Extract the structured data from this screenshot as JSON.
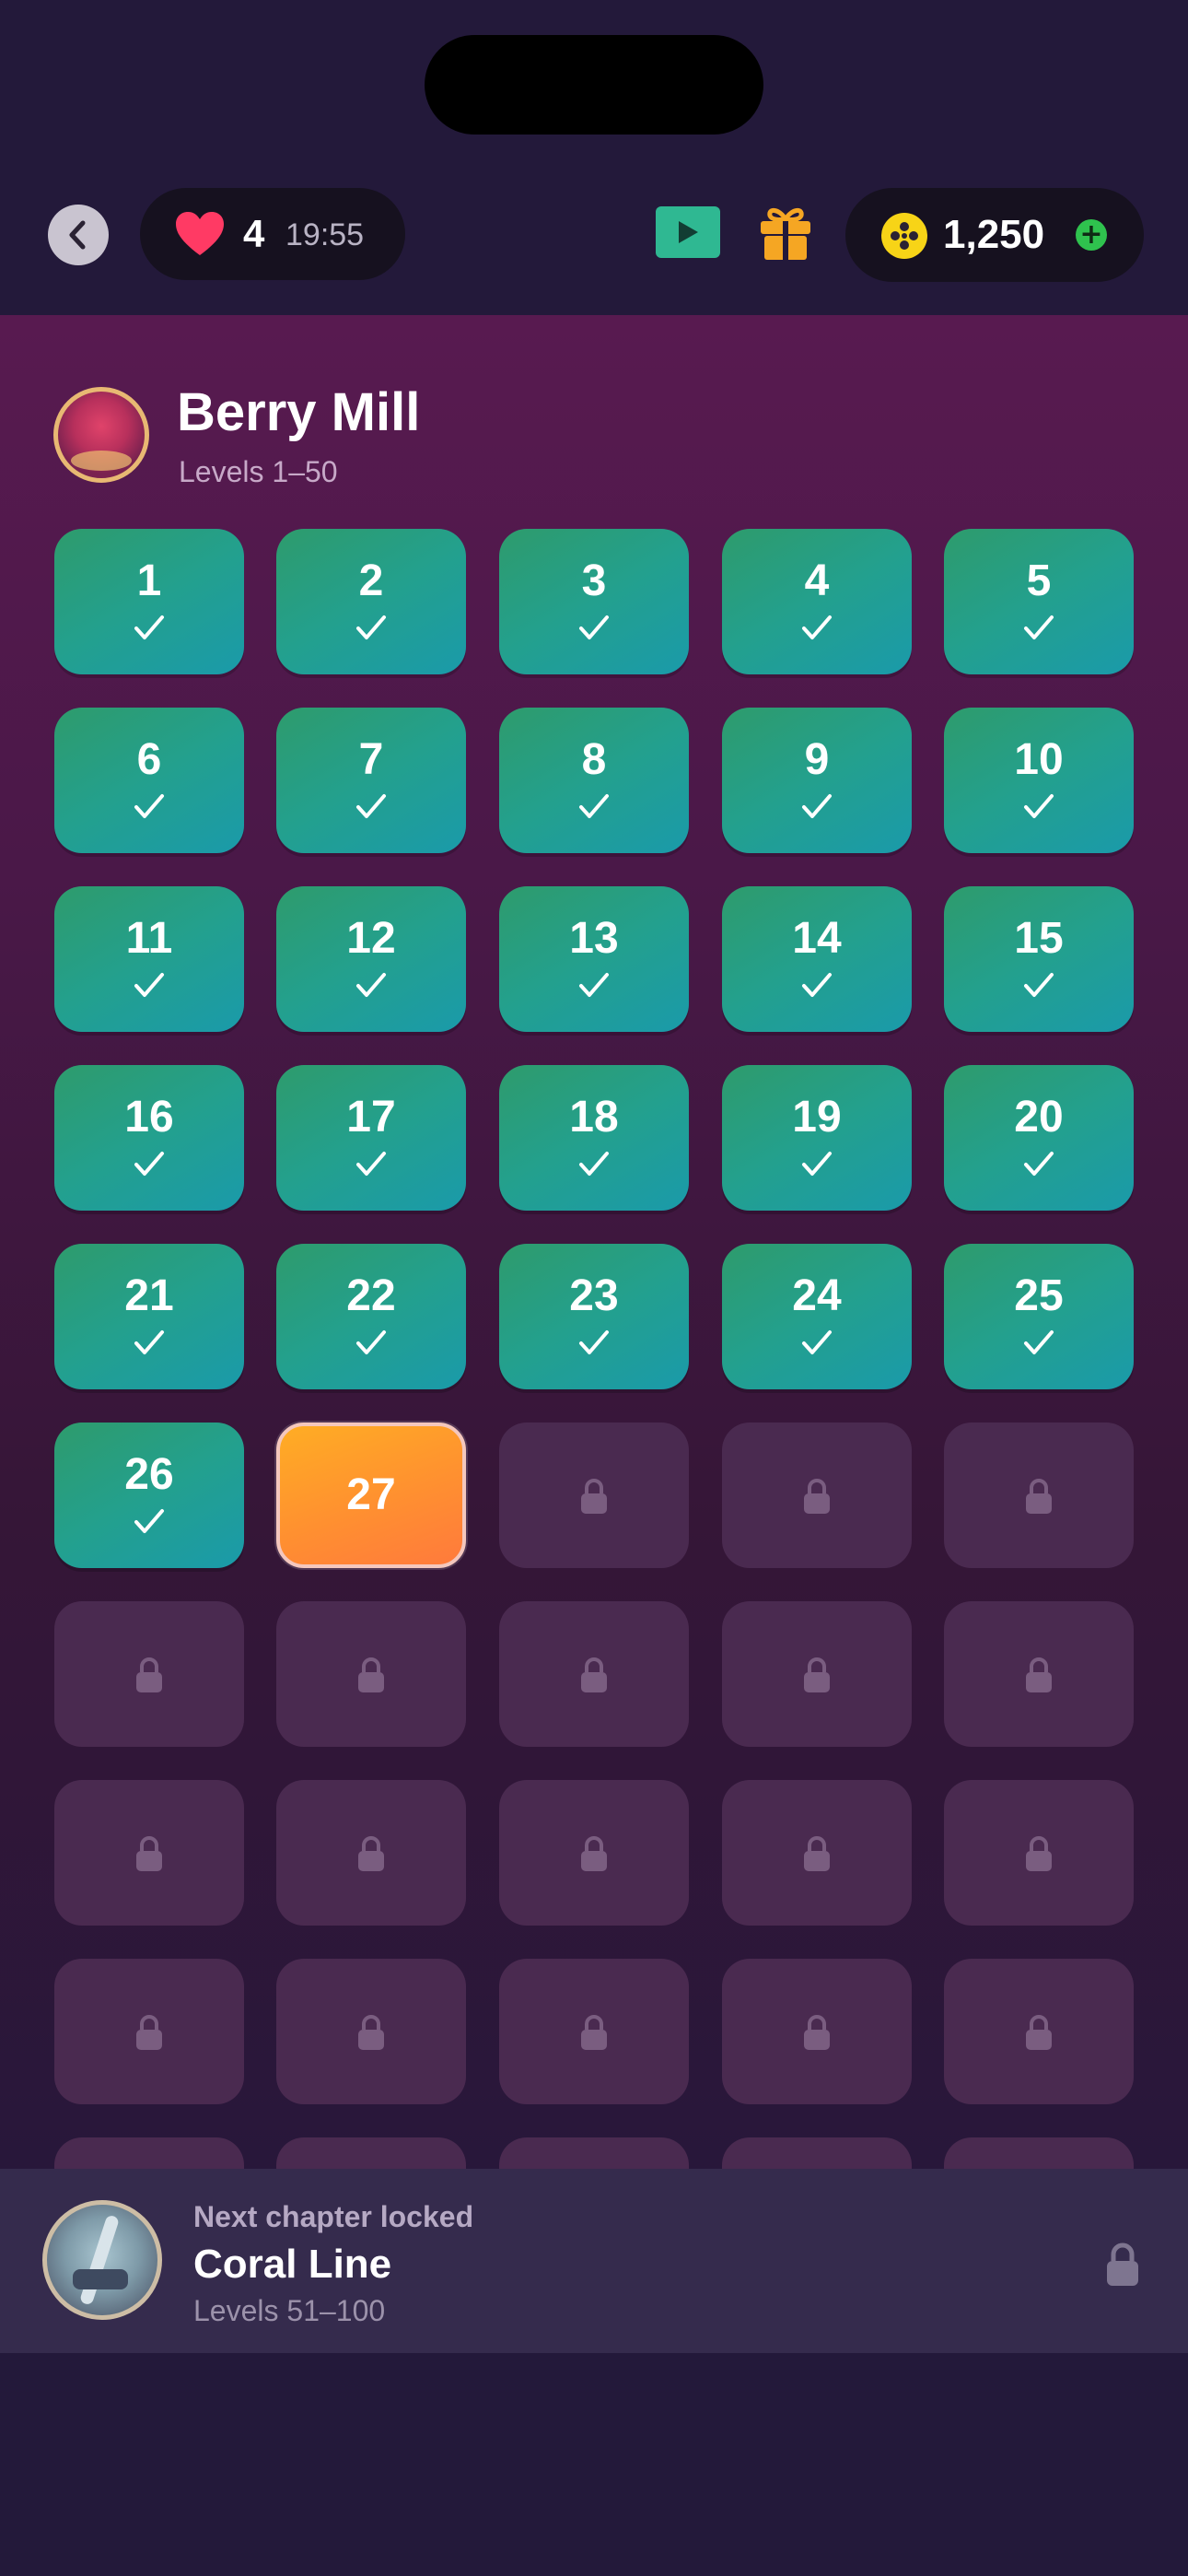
{
  "status": {
    "lives": "4",
    "timer": "19:55",
    "coins": "1,250"
  },
  "icons": {
    "back": "chevron-left-icon",
    "heart": "heart-icon",
    "video": "play-video-icon",
    "gift": "gift-icon",
    "coin": "coin-icon",
    "add": "plus-icon",
    "check": "check-icon",
    "lock": "lock-icon"
  },
  "colors": {
    "completed_tile": "#23a08e",
    "current_tile": "#ff9030",
    "locked_tile": "#4a2a50",
    "background": "#23193a",
    "heart": "#ff3a64"
  },
  "chapter": {
    "title": "Berry Mill",
    "subtitle": "Levels 1–50"
  },
  "levels": {
    "completed": [
      "1",
      "2",
      "3",
      "4",
      "5",
      "6",
      "7",
      "8",
      "9",
      "10",
      "11",
      "12",
      "13",
      "14",
      "15",
      "16",
      "17",
      "18",
      "19",
      "20",
      "21",
      "22",
      "23",
      "24",
      "25",
      "26"
    ],
    "current": "27",
    "locked_count": 23
  },
  "next_chapter": {
    "label": "Next chapter locked",
    "title": "Coral Line",
    "subtitle": "Levels 51–100"
  }
}
